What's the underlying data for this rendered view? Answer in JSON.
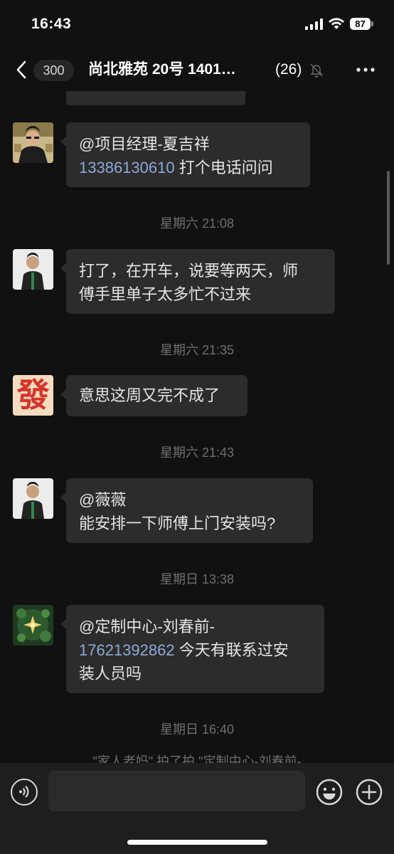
{
  "status_bar": {
    "time": "16:43",
    "battery": "87"
  },
  "header": {
    "back_badge": "300",
    "title": "尚北雅苑 20号 1401…",
    "member_count": "(26)"
  },
  "messages": [
    {
      "text_prefix": "@项目经理-夏吉祥\n",
      "phone": "13386130610",
      "text_suffix": " 打个电话问问"
    },
    {
      "timestamp": "星期六 21:08"
    },
    {
      "text": "打了，在开车，说要等两天，师\n傅手里单子太多忙不过来"
    },
    {
      "timestamp": "星期六 21:35"
    },
    {
      "text": "意思这周又完不成了"
    },
    {
      "timestamp": "星期六 21:43"
    },
    {
      "text": "@薇薇\n能安排一下师傅上门安装吗?"
    },
    {
      "timestamp": "星期日 13:38"
    },
    {
      "text_prefix": "@定制中心-刘春前-\n",
      "phone": "17621392862",
      "text_suffix": " 今天有联系过安\n装人员吗"
    },
    {
      "timestamp": "星期日 16:40"
    },
    {
      "system": "\"家人老妈\" 拍了拍 \"定制中心-刘春前-"
    }
  ],
  "avatars": {
    "fa_glyph": "發"
  },
  "input": {
    "value": ""
  }
}
